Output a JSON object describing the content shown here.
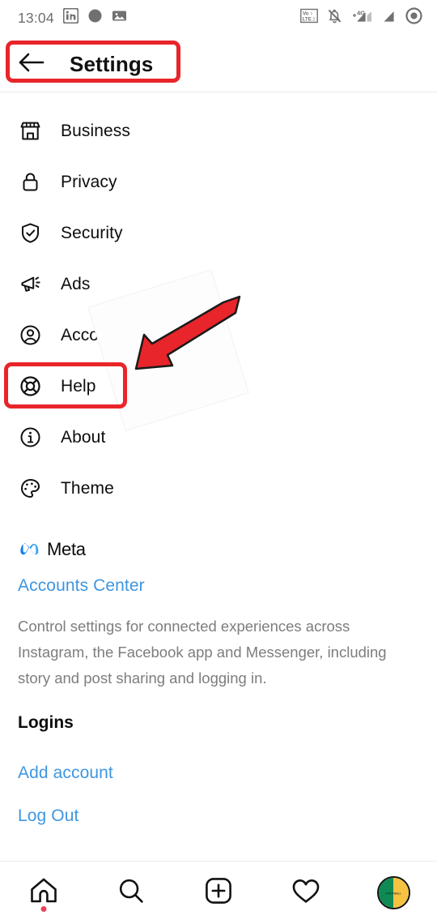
{
  "status_bar": {
    "time": "13:04",
    "left_icons": [
      "linkedin-icon",
      "circle-icon",
      "gallery-icon"
    ],
    "right_icons": [
      "volte-icon",
      "notifications-muted-icon",
      "signal-4g-icon",
      "signal-icon",
      "record-icon"
    ]
  },
  "header": {
    "title": "Settings",
    "back_icon": "back-arrow-icon"
  },
  "menu": {
    "items": [
      {
        "label": "Business",
        "icon": "storefront-icon"
      },
      {
        "label": "Privacy",
        "icon": "lock-icon"
      },
      {
        "label": "Security",
        "icon": "shield-check-icon"
      },
      {
        "label": "Ads",
        "icon": "megaphone-icon"
      },
      {
        "label": "Account",
        "icon": "person-circle-icon"
      },
      {
        "label": "Help",
        "icon": "lifebuoy-icon"
      },
      {
        "label": "About",
        "icon": "info-circle-icon"
      },
      {
        "label": "Theme",
        "icon": "palette-icon"
      }
    ]
  },
  "meta_section": {
    "brand": "Meta",
    "logo_icon": "meta-infinity-icon",
    "accounts_center": "Accounts Center",
    "description": "Control settings for connected experiences across Instagram, the Facebook app and Messenger, including story and post sharing and logging in."
  },
  "logins_section": {
    "title": "Logins",
    "add_account": "Add account",
    "log_out": "Log Out"
  },
  "bottom_nav": {
    "items": [
      {
        "icon": "home-icon"
      },
      {
        "icon": "search-icon"
      },
      {
        "icon": "add-post-icon"
      },
      {
        "icon": "heart-icon"
      },
      {
        "icon": "profile-avatar"
      }
    ],
    "avatar_text": "FOOTBALL"
  },
  "annotations": {
    "settings_highlight": "red-box-settings",
    "help_highlight": "red-box-help",
    "arrow": "red-arrow-pointing-to-help"
  },
  "colors": {
    "link_blue": "#3f96e0",
    "annotation_red": "#e8252a",
    "text_primary": "#0d0d0d",
    "text_secondary": "#7d7d7d"
  }
}
